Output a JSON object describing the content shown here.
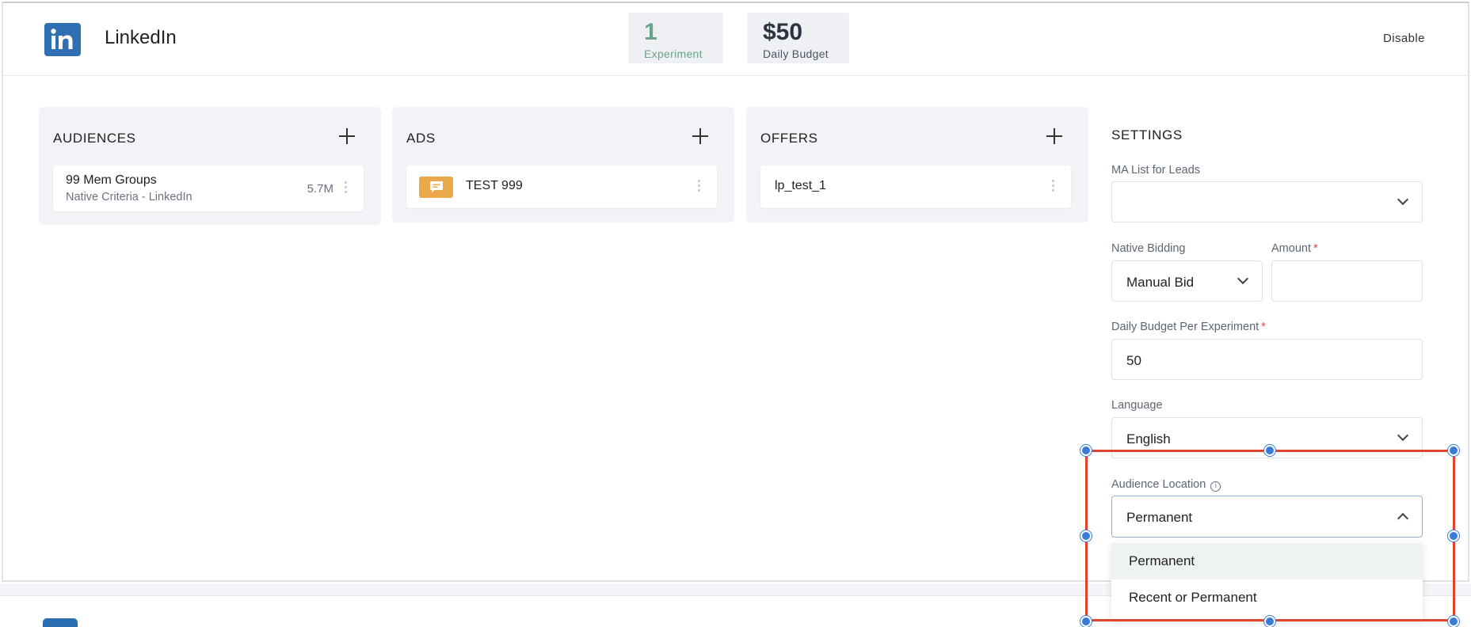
{
  "header": {
    "app_title": "LinkedIn",
    "stats": [
      {
        "value": "1",
        "label": "Experiment"
      },
      {
        "value": "$50",
        "label": "Daily Budget"
      }
    ],
    "disable_label": "Disable"
  },
  "audiences": {
    "title": "AUDIENCES",
    "items": [
      {
        "name": "99 Mem Groups",
        "sub": "Native Criteria - LinkedIn",
        "size": "5.7M"
      }
    ]
  },
  "ads": {
    "title": "ADS",
    "items": [
      {
        "name": "TEST 999"
      }
    ]
  },
  "offers": {
    "title": "OFFERS",
    "items": [
      {
        "name": "lp_test_1"
      }
    ]
  },
  "settings": {
    "title": "SETTINGS",
    "ma_list": {
      "label": "MA List for Leads",
      "value": ""
    },
    "native_bidding": {
      "label": "Native Bidding",
      "value": "Manual Bid"
    },
    "amount": {
      "label": "Amount",
      "required": "*",
      "value": ""
    },
    "daily_budget": {
      "label": "Daily Budget Per Experiment",
      "required": "*",
      "value": "50"
    },
    "language": {
      "label": "Language",
      "value": "English"
    },
    "audience_location": {
      "label": "Audience Location",
      "value": "Permanent",
      "options": [
        "Permanent",
        "Recent or Permanent"
      ]
    }
  },
  "colors": {
    "linkedin_blue": "#2f6fb2",
    "experiment_green": "#6aa28a",
    "ad_badge": "#e9a84a",
    "required_red": "#e0483e",
    "selection_red": "#e0452d",
    "handle_blue": "#3a7bd5"
  },
  "icons": {
    "logo": "linkedin-logo-icon",
    "add": "plus-icon",
    "menu": "kebab-menu-icon",
    "ad": "chat-bubble-icon",
    "dropdown": "chevron-down-icon",
    "dropdown_open": "chevron-up-icon",
    "info": "info-icon"
  }
}
